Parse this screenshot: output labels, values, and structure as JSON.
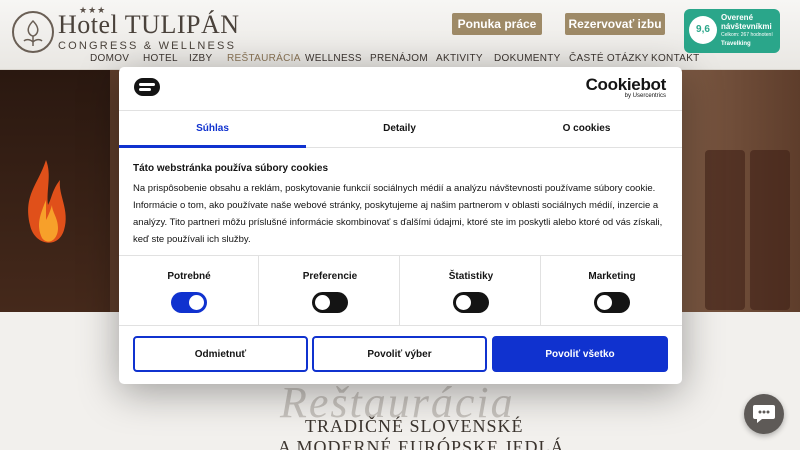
{
  "header": {
    "stars": "★★★",
    "title": "Hotel TULIPÁN",
    "subtitle": "CONGRESS & WELLNESS",
    "job_button": "Ponuka práce",
    "reserve_button": "Rezervovať izbu",
    "badge": {
      "score": "9,6",
      "title": "Overené návštevníkmi",
      "subtitle": "Celkom: 267 hodnotení",
      "brand": "Travelking"
    }
  },
  "nav": {
    "items": [
      "DOMOV",
      "HOTEL",
      "IZBY",
      "REŠTAURÁCIA",
      "WELLNESS",
      "PRENÁJOM",
      "AKTIVITY",
      "DOKUMENTY",
      "ČASTÉ OTÁZKY",
      "KONTAKT"
    ],
    "active": "REŠTAURÁCIA"
  },
  "cookie": {
    "brand": "Cookiebot",
    "brand_by": "by Usercentrics",
    "tabs": [
      "Súhlas",
      "Detaily",
      "O cookies"
    ],
    "active_tab": "Súhlas",
    "title": "Táto webstránka používa súbory cookies",
    "text": "Na prispôsobenie obsahu a reklám, poskytovanie funkcií sociálnych médií a analýzu návštevnosti používame súbory cookie. Informácie o tom, ako používate naše webové stránky, poskytujeme aj našim partnerom v oblasti sociálnych médií, inzercie a analýzy. Tito partneri môžu príslušné informácie skombinovať s ďalšími údajmi, ktoré ste im poskytli alebo ktoré od vás získali, keď ste používali ich služby.",
    "categories": [
      {
        "label": "Potrebné",
        "on": true
      },
      {
        "label": "Preferencie",
        "on": false
      },
      {
        "label": "Štatistiky",
        "on": false
      },
      {
        "label": "Marketing",
        "on": false
      }
    ],
    "buttons": {
      "deny": "Odmietnuť",
      "allow_selection": "Povoliť výber",
      "allow_all": "Povoliť všetko"
    }
  },
  "restaurant": {
    "script_title": "Reštaurácia",
    "line1": "TRADIČNÉ SLOVENSKÉ",
    "line2": "A MODERNÉ EURÓPSKE JEDLÁ"
  },
  "colors": {
    "accent": "#1032cf",
    "header_button": "#9e8a67",
    "badge": "#2aa68a"
  }
}
